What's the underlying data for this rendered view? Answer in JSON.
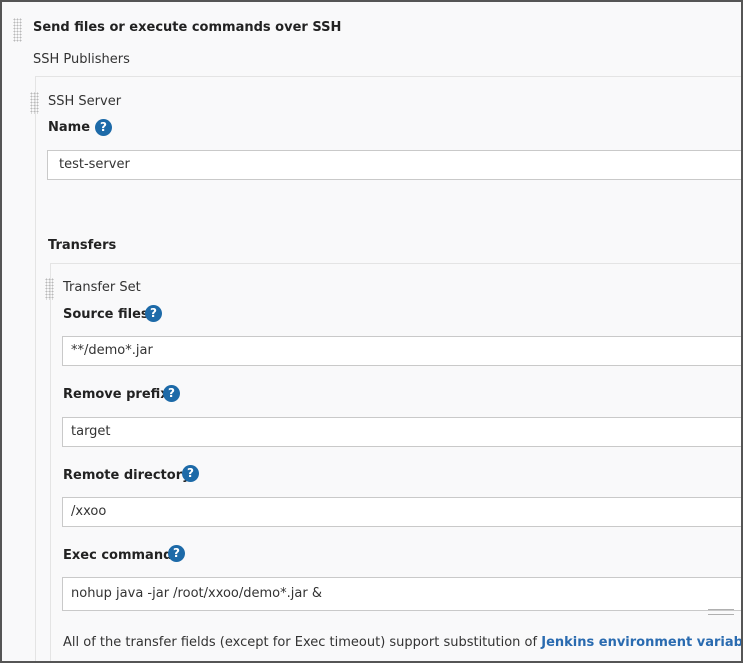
{
  "section": {
    "title": "Send files or execute commands over SSH",
    "publishers_label": "SSH Publishers"
  },
  "ssh_server": {
    "header": "SSH Server",
    "name_label": "Name",
    "name_value": "test-server",
    "transfers_label": "Transfers"
  },
  "transfer_set": {
    "header": "Transfer Set",
    "source_files_label": "Source files",
    "source_files_value": "**/demo*.jar",
    "remove_prefix_label": "Remove prefix",
    "remove_prefix_value": "target",
    "remote_directory_label": "Remote directory",
    "remote_directory_value": "/xxoo",
    "exec_command_label": "Exec command",
    "exec_command_value": "nohup java -jar /root/xxoo/demo*.jar &",
    "note_text": "All of the transfer fields (except for Exec timeout) support substitution of",
    "note_link": "Jenkins environment variables"
  },
  "help_glyph": "?",
  "icons": [
    "drag-handle-icon",
    "help-icon",
    "textarea-resize-icon"
  ]
}
